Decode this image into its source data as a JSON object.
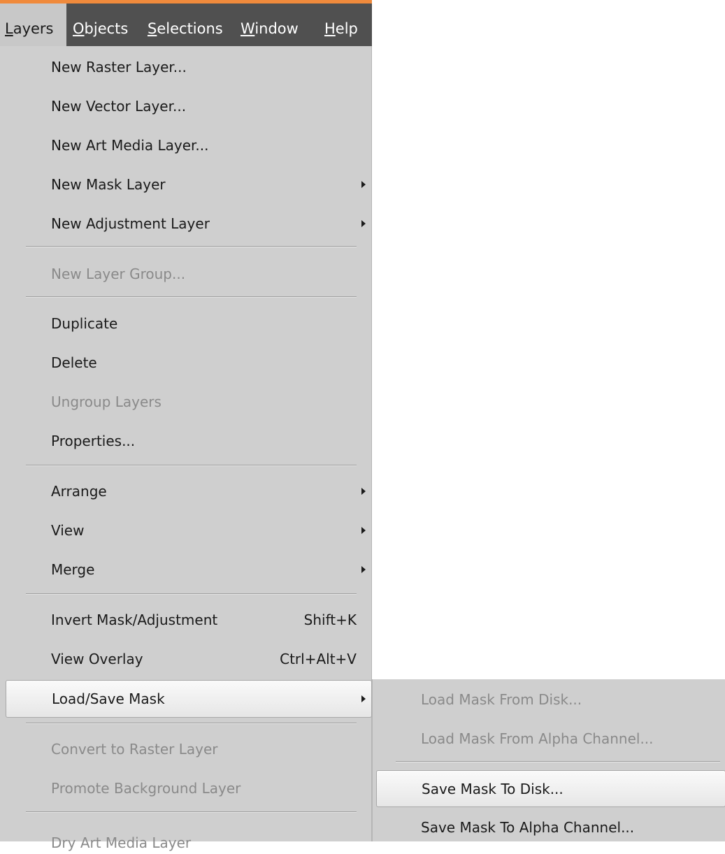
{
  "menubar": {
    "items": [
      {
        "mnemonic": "L",
        "rest": "ayers"
      },
      {
        "mnemonic": "O",
        "rest": "bjects"
      },
      {
        "mnemonic": "S",
        "rest": "elections"
      },
      {
        "mnemonic": "W",
        "rest": "indow"
      },
      {
        "mnemonic": "H",
        "rest": "elp"
      }
    ]
  },
  "layers_menu": {
    "items": [
      {
        "label": "New Raster Layer..."
      },
      {
        "label": "New Vector Layer..."
      },
      {
        "label": "New Art Media Layer..."
      },
      {
        "label": "New Mask Layer"
      },
      {
        "label": "New Adjustment Layer"
      },
      {
        "label": "New Layer Group..."
      },
      {
        "label": "Duplicate"
      },
      {
        "label": "Delete"
      },
      {
        "label": "Ungroup Layers"
      },
      {
        "label": "Properties..."
      },
      {
        "label": "Arrange"
      },
      {
        "label": "View"
      },
      {
        "label": "Merge"
      },
      {
        "label": "Invert Mask/Adjustment",
        "shortcut": "Shift+K"
      },
      {
        "label": "View Overlay",
        "shortcut": "Ctrl+Alt+V"
      },
      {
        "label": "Load/Save Mask"
      },
      {
        "label": "Convert to Raster Layer"
      },
      {
        "label": "Promote Background Layer"
      },
      {
        "label": "Dry Art Media Layer"
      }
    ]
  },
  "load_save_mask_submenu": {
    "items": [
      {
        "label": "Load Mask From Disk..."
      },
      {
        "label": "Load Mask From Alpha Channel..."
      },
      {
        "label": "Save Mask To Disk..."
      },
      {
        "label": "Save Mask To Alpha Channel..."
      }
    ]
  },
  "colors": {
    "accent": "#f08a3c",
    "menubar_bg": "#505050",
    "menu_bg": "#cfcfcf",
    "disabled_text": "#8a8a8a"
  }
}
